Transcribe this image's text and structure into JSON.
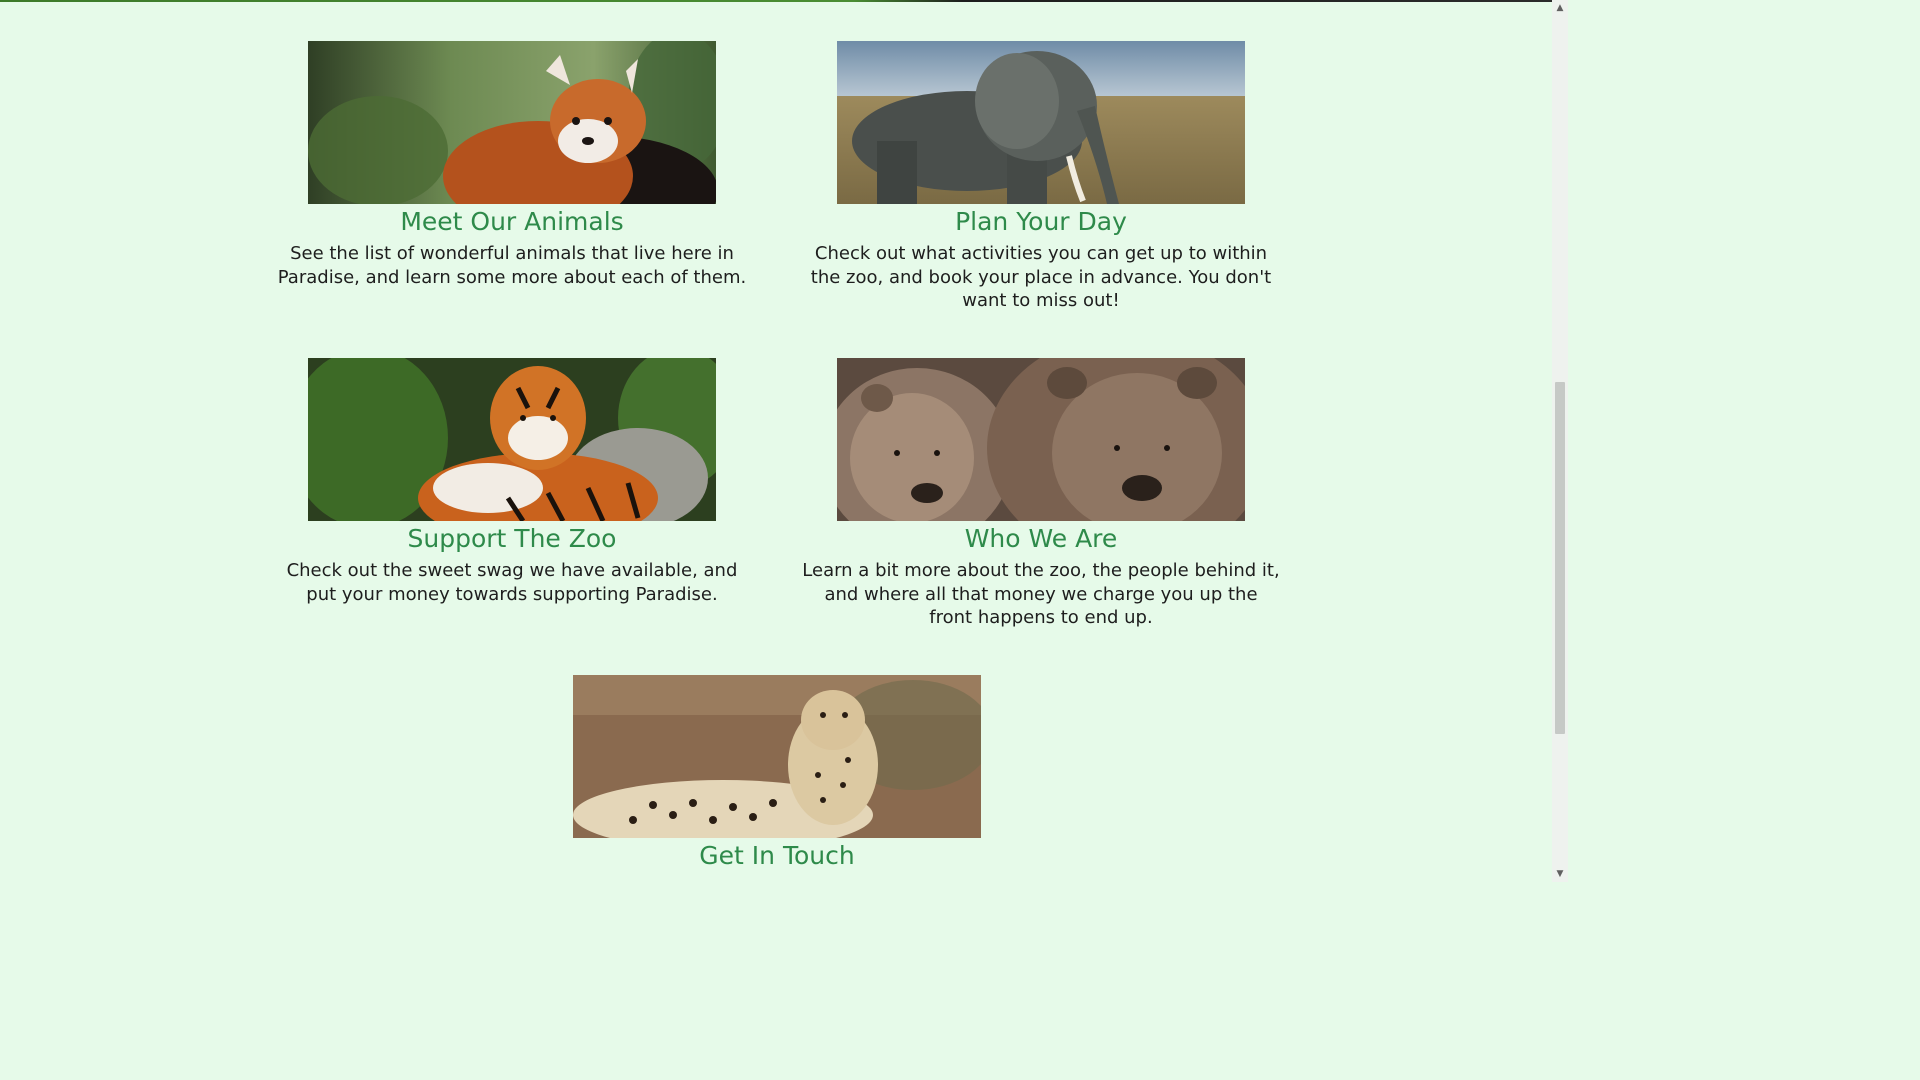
{
  "cards": [
    {
      "title": "Meet Our Animals",
      "text": "See the list of wonderful animals that live here in Paradise, and learn some more about each of them.",
      "image": "red-panda-photo"
    },
    {
      "title": "Plan Your Day",
      "text": "Check out what activities you can get up to within the zoo, and book your place in advance. You don't want to miss out!",
      "image": "elephant-photo"
    },
    {
      "title": "Support The Zoo",
      "text": "Check out the sweet swag we have available, and put your money towards supporting Paradise.",
      "image": "tiger-photo"
    },
    {
      "title": "Who We Are",
      "text": "Learn a bit more about the zoo, the people behind it, and where all that money we charge you up the front happens to end up.",
      "image": "bears-photo"
    },
    {
      "title": "Get In Touch",
      "text": "",
      "image": "cheetah-photo"
    }
  ],
  "colors": {
    "page_background": "#e6fae9",
    "heading": "#2e8a4a",
    "body_text": "#1e1e1e"
  }
}
